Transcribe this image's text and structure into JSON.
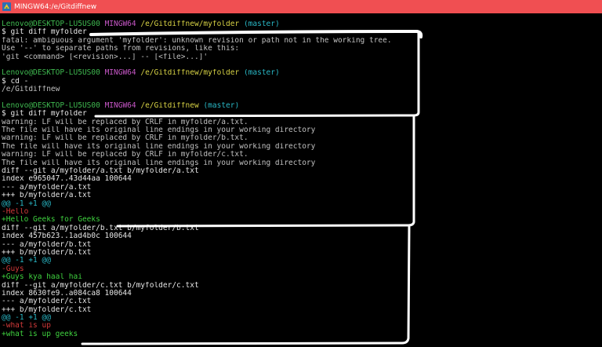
{
  "window": {
    "title": "MINGW64:/e/Gitdiffnew"
  },
  "colors": {
    "titlebar": "#f04f52",
    "background": "#000000",
    "user": "#3fb950",
    "msystem": "#c757c7",
    "path": "#d8d345",
    "branch": "#29b8c6",
    "hunk": "#29b8c6",
    "deletion": "#d23a3a",
    "addition": "#3fd23f",
    "text": "#c0c0c0"
  },
  "terminal": {
    "lines": [
      {
        "kind": "prompt",
        "user": "Lenovo@DESKTOP-LU5US00",
        "msys": "MINGW64",
        "path": "/e/Gitdiffnew/myfolder",
        "branch": "(master)"
      },
      {
        "kind": "cmd",
        "text": "$ git diff myfolder"
      },
      {
        "kind": "normal",
        "text": "fatal: ambiguous argument 'myfolder': unknown revision or path not in the working tree."
      },
      {
        "kind": "normal",
        "text": "Use '--' to separate paths from revisions, like this:"
      },
      {
        "kind": "normal",
        "text": "'git <command> [<revision>...] -- [<file>...]'"
      },
      {
        "kind": "blank",
        "text": ""
      },
      {
        "kind": "prompt",
        "user": "Lenovo@DESKTOP-LU5US00",
        "msys": "MINGW64",
        "path": "/e/Gitdiffnew/myfolder",
        "branch": "(master)"
      },
      {
        "kind": "cmd",
        "text": "$ cd -"
      },
      {
        "kind": "normal",
        "text": "/e/Gitdiffnew"
      },
      {
        "kind": "blank",
        "text": ""
      },
      {
        "kind": "prompt",
        "user": "Lenovo@DESKTOP-LU5US00",
        "msys": "MINGW64",
        "path": "/e/Gitdiffnew",
        "branch": "(master)"
      },
      {
        "kind": "cmd",
        "text": "$ git diff myfolder"
      },
      {
        "kind": "normal",
        "text": "warning: LF will be replaced by CRLF in myfolder/a.txt."
      },
      {
        "kind": "normal",
        "text": "The file will have its original line endings in your working directory"
      },
      {
        "kind": "normal",
        "text": "warning: LF will be replaced by CRLF in myfolder/b.txt."
      },
      {
        "kind": "normal",
        "text": "The file will have its original line endings in your working directory"
      },
      {
        "kind": "normal",
        "text": "warning: LF will be replaced by CRLF in myfolder/c.txt."
      },
      {
        "kind": "normal",
        "text": "The file will have its original line endings in your working directory"
      },
      {
        "kind": "white",
        "text": "diff --git a/myfolder/a.txt b/myfolder/a.txt"
      },
      {
        "kind": "white",
        "text": "index e965047..43d44aa 100644"
      },
      {
        "kind": "white",
        "text": "--- a/myfolder/a.txt"
      },
      {
        "kind": "white",
        "text": "+++ b/myfolder/a.txt"
      },
      {
        "kind": "hunk",
        "text": "@@ -1 +1 @@"
      },
      {
        "kind": "del",
        "text": "-Hello"
      },
      {
        "kind": "add",
        "text": "+Hello Geeks for Geeks"
      },
      {
        "kind": "white",
        "text": "diff --git a/myfolder/b.txt b/myfolder/b.txt"
      },
      {
        "kind": "white",
        "text": "index 457b623..1ad4b0c 100644"
      },
      {
        "kind": "white",
        "text": "--- a/myfolder/b.txt"
      },
      {
        "kind": "white",
        "text": "+++ b/myfolder/b.txt"
      },
      {
        "kind": "hunk",
        "text": "@@ -1 +1 @@"
      },
      {
        "kind": "del",
        "text": "-Guys"
      },
      {
        "kind": "add",
        "text": "+Guys kya haal hai"
      },
      {
        "kind": "white",
        "text": "diff --git a/myfolder/c.txt b/myfolder/c.txt"
      },
      {
        "kind": "white",
        "text": "index 8630fe9..a084ca8 100644"
      },
      {
        "kind": "white",
        "text": "--- a/myfolder/c.txt"
      },
      {
        "kind": "white",
        "text": "+++ b/myfolder/c.txt"
      },
      {
        "kind": "hunk",
        "text": "@@ -1 +1 @@"
      },
      {
        "kind": "del",
        "text": "-what is up"
      },
      {
        "kind": "add",
        "text": "+what is up geeks"
      }
    ]
  }
}
